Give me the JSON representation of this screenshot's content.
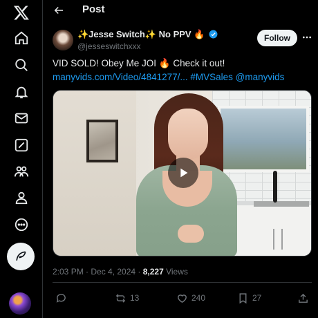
{
  "header": {
    "title": "Post"
  },
  "post": {
    "author_name": "✨Jesse Switch✨ No PPV 🔥",
    "handle": "@jesseswitchxxx",
    "follow_label": "Follow",
    "text_line1": "VID SOLD! Obey Me JOI 🔥 Check it out!",
    "text_line2": "manyvids.com/Video/4841277/... #MVSales @manyvids",
    "timestamp": "2:03 PM · Dec 4, 2024 · ",
    "views_count": "8,227",
    "views_label": " Views"
  },
  "actions": {
    "reposts": "13",
    "likes": "240",
    "bookmarks": "27"
  },
  "colors": {
    "accent": "#1d9bf0",
    "background": "#000000",
    "muted": "#71767b",
    "text": "#e7e9ea"
  },
  "icons": {
    "nav": [
      "x-logo-icon",
      "home-icon",
      "search-icon",
      "bell-icon",
      "mail-icon",
      "grok-icon",
      "communities-icon",
      "profile-icon",
      "more-circle-icon",
      "compose-feather-icon"
    ],
    "post": [
      "back-arrow-icon",
      "verified-badge-icon",
      "more-dots-icon",
      "play-icon",
      "reply-icon",
      "repost-icon",
      "like-icon",
      "bookmark-icon",
      "share-icon"
    ]
  }
}
